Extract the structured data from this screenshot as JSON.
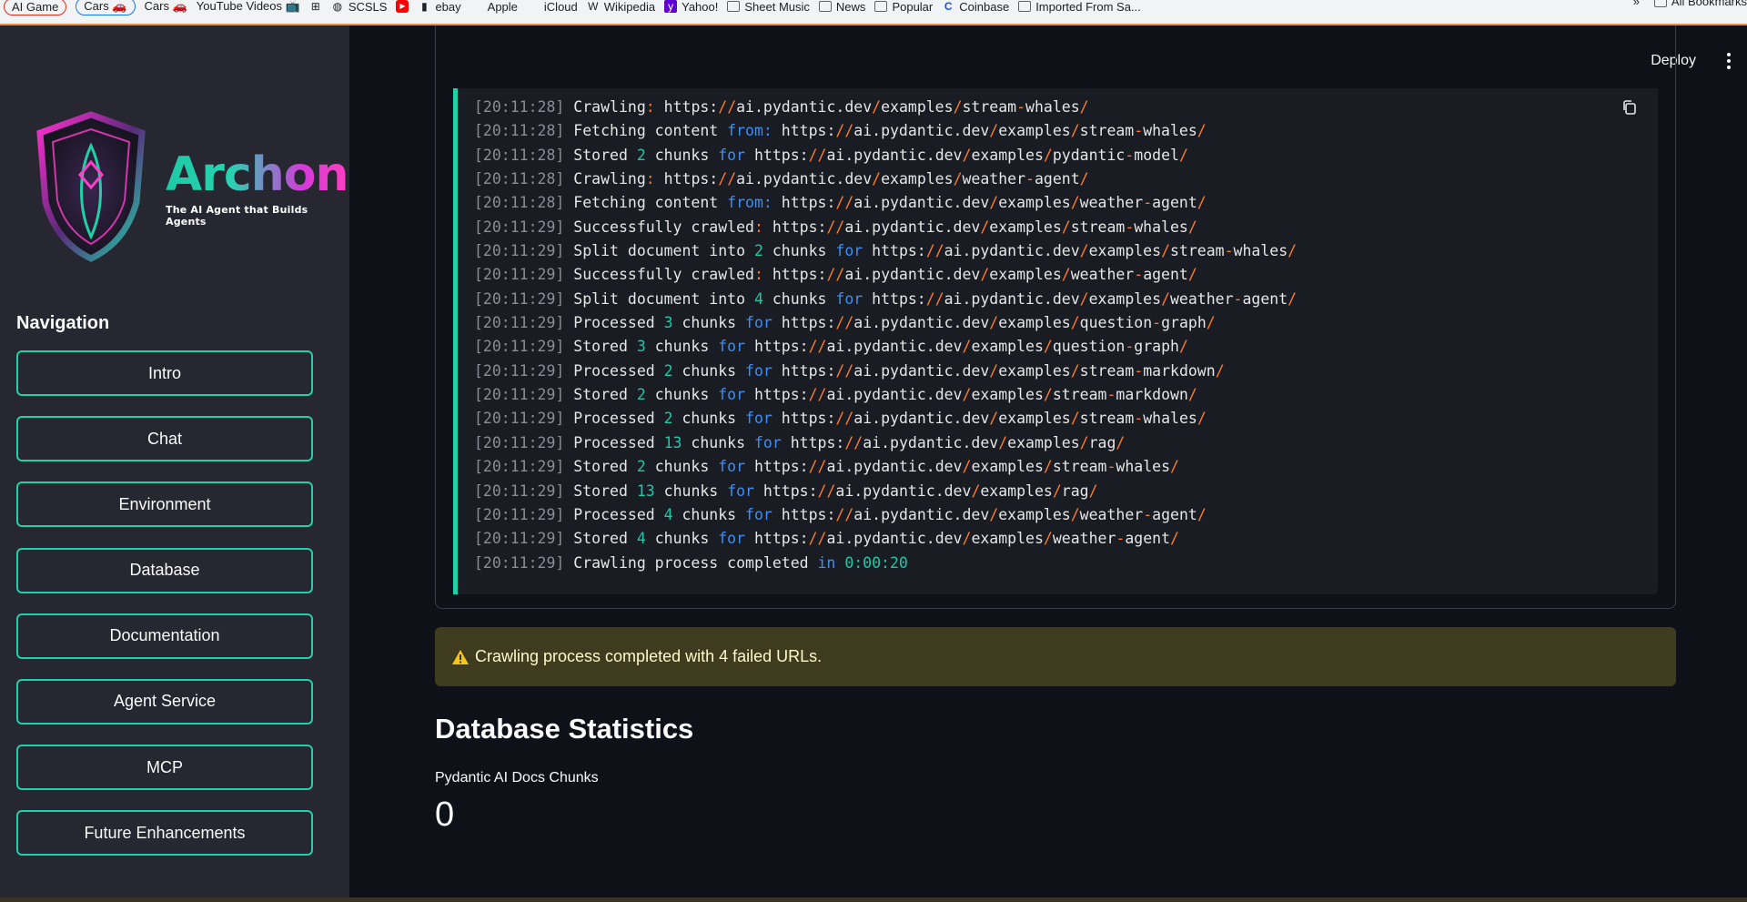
{
  "bookmarks": {
    "left": [
      {
        "label": "AI Game",
        "icon": "bookmark-icon",
        "style": "pill-red"
      },
      {
        "label": "Cars 🚗",
        "icon": "bookmark-icon",
        "style": "pill-blue"
      },
      {
        "label": "Cars 🚗",
        "icon": "bookmark-icon",
        "style": "plain"
      },
      {
        "label": "YouTube Videos 📺",
        "icon": "bookmark-icon",
        "style": "plain"
      },
      {
        "label": "",
        "icon": "apps-grid-icon",
        "style": "plain"
      },
      {
        "label": "SCSLS",
        "icon": "globe-icon",
        "style": "plain"
      },
      {
        "label": "",
        "icon": "youtube-icon",
        "style": "plain"
      },
      {
        "label": "ebay",
        "icon": "ebay-icon",
        "style": "plain"
      },
      {
        "label": "Apple",
        "icon": "apple-icon",
        "style": "plain"
      },
      {
        "label": "iCloud",
        "icon": "apple-icon",
        "style": "plain"
      },
      {
        "label": "Wikipedia",
        "icon": "wikipedia-icon",
        "style": "plain"
      },
      {
        "label": "Yahoo!",
        "icon": "yahoo-icon",
        "style": "plain"
      },
      {
        "label": "Sheet Music",
        "icon": "folder-icon",
        "style": "plain"
      },
      {
        "label": "News",
        "icon": "folder-icon",
        "style": "plain"
      },
      {
        "label": "Popular",
        "icon": "folder-icon",
        "style": "plain"
      },
      {
        "label": "Coinbase",
        "icon": "coinbase-icon",
        "style": "plain"
      },
      {
        "label": "Imported From Sa...",
        "icon": "folder-icon",
        "style": "plain"
      }
    ],
    "overflow": "»",
    "all_bookmarks": "All Bookmarks"
  },
  "sidebar": {
    "logo_title": "Archon",
    "logo_subtitle": "The AI Agent that Builds Agents",
    "nav_title": "Navigation",
    "nav_items": [
      {
        "label": "Intro"
      },
      {
        "label": "Chat"
      },
      {
        "label": "Environment"
      },
      {
        "label": "Database"
      },
      {
        "label": "Documentation"
      },
      {
        "label": "Agent Service"
      },
      {
        "label": "MCP"
      },
      {
        "label": "Future Enhancements"
      }
    ]
  },
  "header": {
    "deploy_label": "Deploy"
  },
  "log": {
    "lines": [
      {
        "ts": "[20:11:28]",
        "text": "Crawling: https://ai.pydantic.dev/examples/stream-whales/"
      },
      {
        "ts": "[20:11:28]",
        "text": "Fetching content from: https://ai.pydantic.dev/examples/stream-whales/"
      },
      {
        "ts": "[20:11:28]",
        "text": "Stored 2 chunks for https://ai.pydantic.dev/examples/pydantic-model/"
      },
      {
        "ts": "[20:11:28]",
        "text": "Crawling: https://ai.pydantic.dev/examples/weather-agent/"
      },
      {
        "ts": "[20:11:28]",
        "text": "Fetching content from: https://ai.pydantic.dev/examples/weather-agent/"
      },
      {
        "ts": "[20:11:29]",
        "text": "Successfully crawled: https://ai.pydantic.dev/examples/stream-whales/"
      },
      {
        "ts": "[20:11:29]",
        "text": "Split document into 2 chunks for https://ai.pydantic.dev/examples/stream-whales/"
      },
      {
        "ts": "[20:11:29]",
        "text": "Successfully crawled: https://ai.pydantic.dev/examples/weather-agent/"
      },
      {
        "ts": "[20:11:29]",
        "text": "Split document into 4 chunks for https://ai.pydantic.dev/examples/weather-agent/"
      },
      {
        "ts": "[20:11:29]",
        "text": "Processed 3 chunks for https://ai.pydantic.dev/examples/question-graph/"
      },
      {
        "ts": "[20:11:29]",
        "text": "Stored 3 chunks for https://ai.pydantic.dev/examples/question-graph/"
      },
      {
        "ts": "[20:11:29]",
        "text": "Processed 2 chunks for https://ai.pydantic.dev/examples/stream-markdown/"
      },
      {
        "ts": "[20:11:29]",
        "text": "Stored 2 chunks for https://ai.pydantic.dev/examples/stream-markdown/"
      },
      {
        "ts": "[20:11:29]",
        "text": "Processed 2 chunks for https://ai.pydantic.dev/examples/stream-whales/"
      },
      {
        "ts": "[20:11:29]",
        "text": "Processed 13 chunks for https://ai.pydantic.dev/examples/rag/"
      },
      {
        "ts": "[20:11:29]",
        "text": "Stored 2 chunks for https://ai.pydantic.dev/examples/stream-whales/"
      },
      {
        "ts": "[20:11:29]",
        "text": "Stored 13 chunks for https://ai.pydantic.dev/examples/rag/"
      },
      {
        "ts": "[20:11:29]",
        "text": "Processed 4 chunks for https://ai.pydantic.dev/examples/weather-agent/"
      },
      {
        "ts": "[20:11:29]",
        "text": "Stored 4 chunks for https://ai.pydantic.dev/examples/weather-agent/"
      },
      {
        "ts": "[20:11:29]",
        "text": "Crawling process completed in 0:00:20"
      }
    ]
  },
  "warning": {
    "icon": "warning-icon",
    "text": "Crawling process completed with 4 failed URLs."
  },
  "stats": {
    "title": "Database Statistics",
    "metric_label": "Pydantic AI Docs Chunks",
    "metric_value": "0"
  },
  "colors": {
    "accent": "#1fd1a6",
    "sidebar_bg": "#262730",
    "main_bg": "#0e1117",
    "warning_bg": "#3e3b1e"
  }
}
